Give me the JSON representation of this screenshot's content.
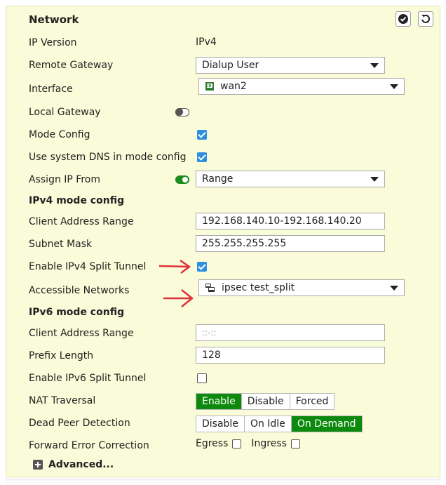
{
  "header": {
    "title": "Network"
  },
  "rows": {
    "ip_version": {
      "label": "IP Version",
      "value": "IPv4"
    },
    "remote_gateway": {
      "label": "Remote Gateway",
      "value": "Dialup User"
    },
    "interface": {
      "label": "Interface",
      "value": "wan2",
      "icon": "interface-port-icon"
    },
    "local_gateway": {
      "label": "Local Gateway",
      "state": "off"
    },
    "mode_config": {
      "label": "Mode Config",
      "checked": true
    },
    "use_system_dns": {
      "label": "Use system DNS in mode config",
      "checked": true
    },
    "assign_ip_from": {
      "label": "Assign IP From",
      "toggle": "on",
      "value": "Range"
    },
    "ipv4_mode_config": {
      "label": "IPv4 mode config"
    },
    "client_address_range_v4": {
      "label": "Client Address Range",
      "value": "192.168.140.10-192.168.140.20"
    },
    "subnet_mask": {
      "label": "Subnet Mask",
      "value": "255.255.255.255"
    },
    "enable_ipv4_split": {
      "label": "Enable IPv4 Split Tunnel",
      "checked": true
    },
    "accessible_networks": {
      "label": "Accessible Networks",
      "value": "ipsec test_split",
      "icon": "address-group-icon"
    },
    "ipv6_mode_config": {
      "label": "IPv6 mode config"
    },
    "client_address_range_v6": {
      "label": "Client Address Range",
      "placeholder": "::-::"
    },
    "prefix_length": {
      "label": "Prefix Length",
      "value": "128"
    },
    "enable_ipv6_split": {
      "label": "Enable IPv6 Split Tunnel",
      "checked": false
    },
    "nat_traversal": {
      "label": "NAT Traversal",
      "options": [
        "Enable",
        "Disable",
        "Forced"
      ],
      "selected": "Enable"
    },
    "dead_peer_detection": {
      "label": "Dead Peer Detection",
      "options": [
        "Disable",
        "On Idle",
        "On Demand"
      ],
      "selected": "On Demand"
    },
    "forward_error_correction": {
      "label": "Forward Error Correction",
      "egress": "Egress",
      "ingress": "Ingress"
    }
  },
  "advanced": {
    "label": "Advanced..."
  },
  "colors": {
    "panel_bg": "#fafbd9",
    "active_green": "#0d8a0d",
    "checkbox_blue": "#2d8fe0",
    "annotation_red": "#e0303a"
  }
}
